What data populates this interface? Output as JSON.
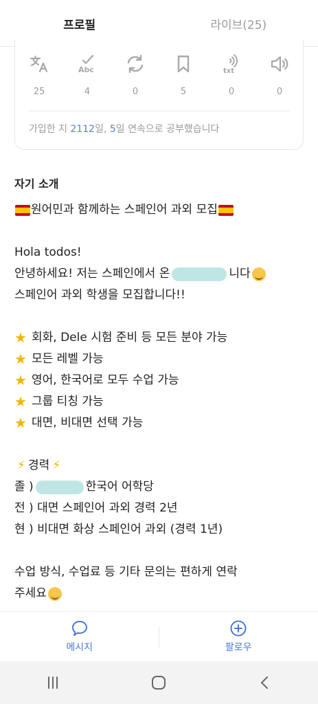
{
  "tabs": [
    {
      "label": "프로필",
      "active": true
    },
    {
      "label": "라이브(25)",
      "active": false
    }
  ],
  "stats": [
    {
      "icon": "translate-icon",
      "count": "25"
    },
    {
      "icon": "spellcheck-icon",
      "count": "4"
    },
    {
      "icon": "refresh-icon",
      "count": "0"
    },
    {
      "icon": "bookmark-icon",
      "count": "5"
    },
    {
      "icon": "text-to-speech-icon",
      "count": "0"
    },
    {
      "icon": "speaker-icon",
      "count": "0"
    }
  ],
  "summary": {
    "prefix": "가입한 지 ",
    "days": "2112",
    "mid": "일, ",
    "streak": "5",
    "suffix": "일 연속으로 공부했습니다"
  },
  "intro": {
    "title": "자기 소개",
    "headline": "원어민과 함께하는 스페인어 과외 모집",
    "greeting": "Hola todos!",
    "hello_pre": "안녕하세요! 저는 스페인에서 온 ",
    "hello_post": "니다",
    "recruit": "스페인어 과외 학생을 모집합니다!!",
    "features": [
      "회화, Dele 시험 준비 등 모든 분야 가능",
      "모든 레벨 가능",
      "영어, 한국어로 모두 수업 가능",
      "그룹 티칭 가능",
      "대면, 비대면 선택 가능"
    ],
    "career_title": "경력",
    "career_1_pre": "졸 ) ",
    "career_1_post": "한국어 어학당",
    "career_2": "전 ) 대면 스페인어 과외 경력 2년",
    "career_3": "현 ) 비대면 화상 스페인어 과외 (경력 1년)",
    "contact_1": "수업 방식, 수업료 등 기타 문의는 편하게 연락",
    "contact_2": "주세요"
  },
  "actions": {
    "message": "메시지",
    "follow": "팔로우"
  },
  "colors": {
    "accent": "#4a78d8",
    "highlight": "#5b7fd2",
    "muted": "#9a9a9a"
  }
}
